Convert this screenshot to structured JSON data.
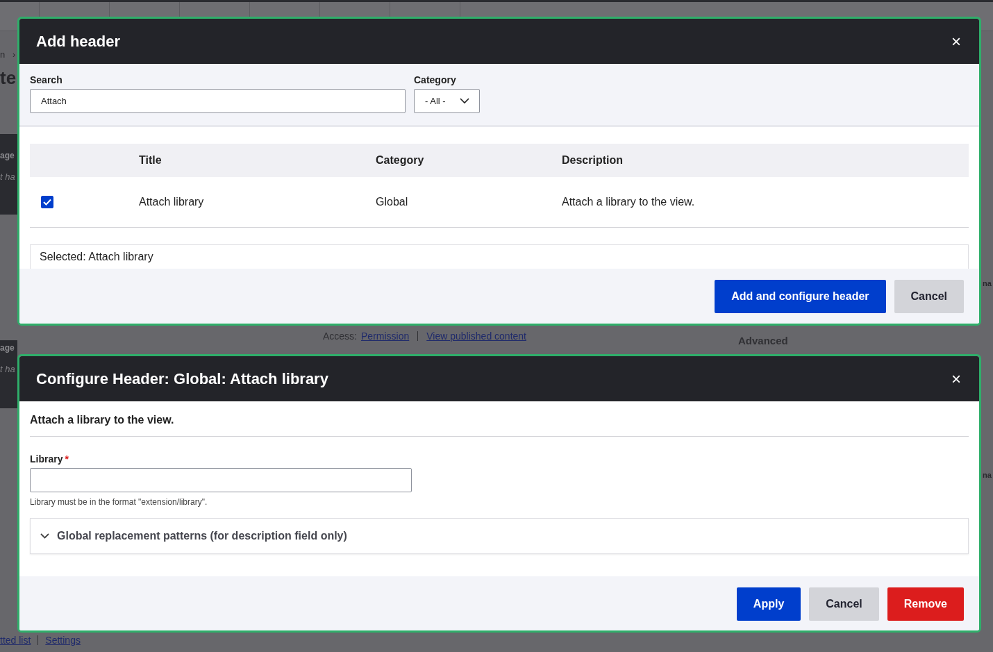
{
  "background_page": {
    "breadcrumb": [
      "n",
      "›"
    ],
    "heading": "te",
    "side_blocks": [
      {
        "title": "age",
        "text": "t ha"
      },
      {
        "title": "age",
        "text": "t ha"
      }
    ],
    "access": {
      "label": "Access:",
      "links": [
        "Permission",
        "View published content"
      ]
    },
    "advanced": "Advanced",
    "right_fragments": [
      "na",
      "na"
    ],
    "footer_links": [
      "tted list",
      "Settings"
    ]
  },
  "add_dialog": {
    "title": "Add header",
    "close": "×",
    "search": {
      "label": "Search",
      "value": "Attach"
    },
    "category": {
      "label": "Category",
      "value": "- All -"
    },
    "table": {
      "columns": [
        "Title",
        "Category",
        "Description"
      ],
      "rows": [
        {
          "checked": true,
          "title": "Attach library",
          "category": "Global",
          "description": "Attach a library to the view."
        }
      ]
    },
    "selected_text": "Selected: Attach library",
    "buttons": [
      {
        "label": "Add and configure header",
        "kind": "primary"
      },
      {
        "label": "Cancel",
        "kind": "secondary"
      }
    ]
  },
  "configure_dialog": {
    "title": "Configure Header: Global: Attach library",
    "close": "×",
    "intro": "Attach a library to the view.",
    "library": {
      "label": "Library",
      "required_mark": "*",
      "description": "Library must be in the format \"extension/library\"."
    },
    "details": {
      "summary": "Global replacement patterns (for description field only)",
      "expanded": false
    },
    "buttons": [
      {
        "label": "Apply",
        "kind": "primary"
      },
      {
        "label": "Cancel",
        "kind": "secondary"
      },
      {
        "label": "Remove",
        "kind": "danger"
      }
    ]
  }
}
